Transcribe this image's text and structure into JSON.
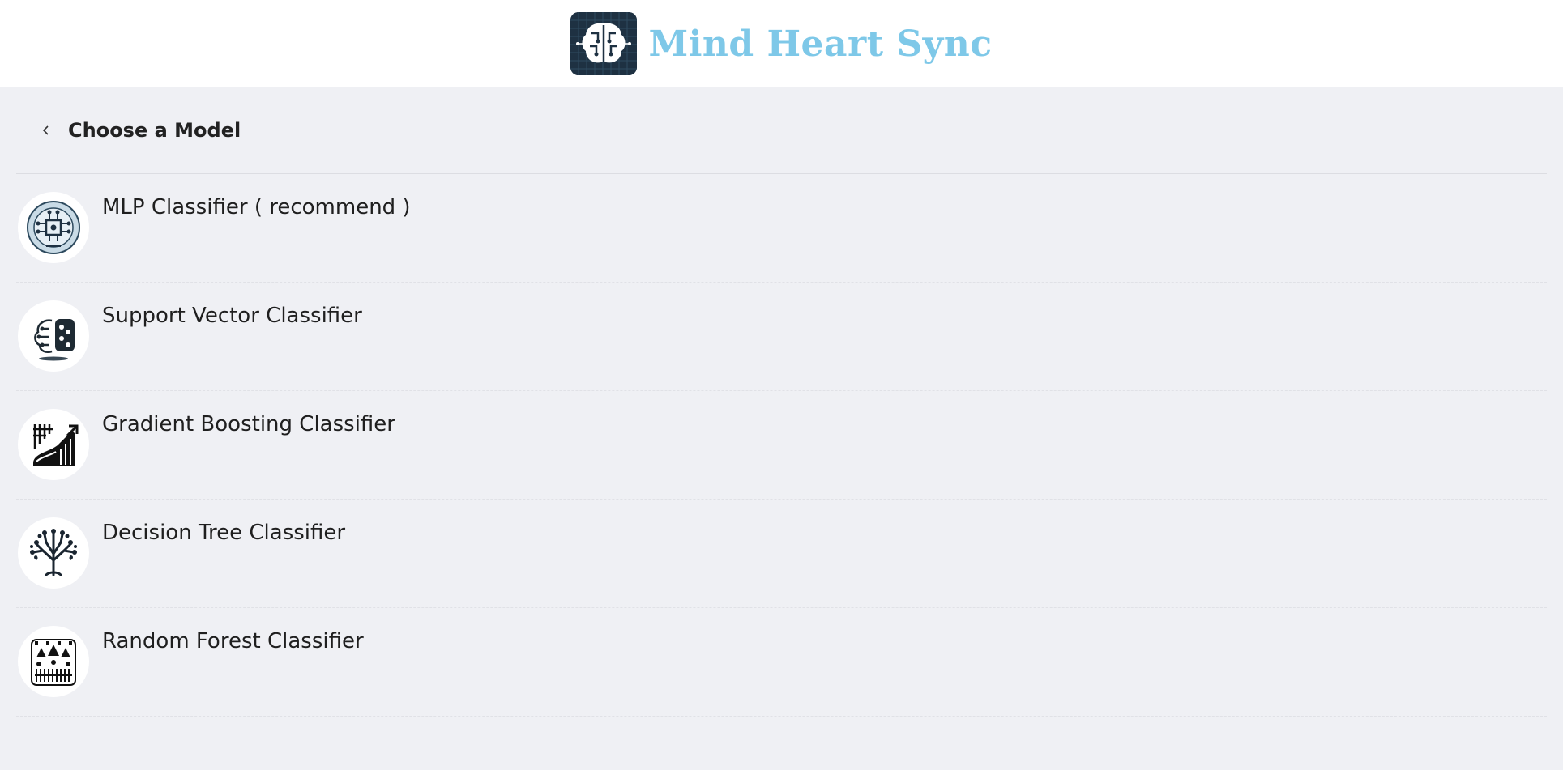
{
  "header": {
    "brand_title": "Mind Heart Sync",
    "logo_icon": "brain-circuit-icon"
  },
  "page": {
    "title": "Choose a Model",
    "back_icon": "chevron-left-icon"
  },
  "models": [
    {
      "label": "MLP Classifier ( recommend )",
      "icon": "neural-network-icon"
    },
    {
      "label": "Support Vector Classifier",
      "icon": "svm-split-icon"
    },
    {
      "label": "Gradient Boosting Classifier",
      "icon": "growth-chart-icon"
    },
    {
      "label": "Decision Tree Classifier",
      "icon": "tree-icon"
    },
    {
      "label": "Random Forest Classifier",
      "icon": "forest-icon"
    }
  ],
  "colors": {
    "brand": "#7ec8e8",
    "background": "#eff0f4",
    "header_bg": "#ffffff",
    "logo_bg": "#1e3142"
  }
}
